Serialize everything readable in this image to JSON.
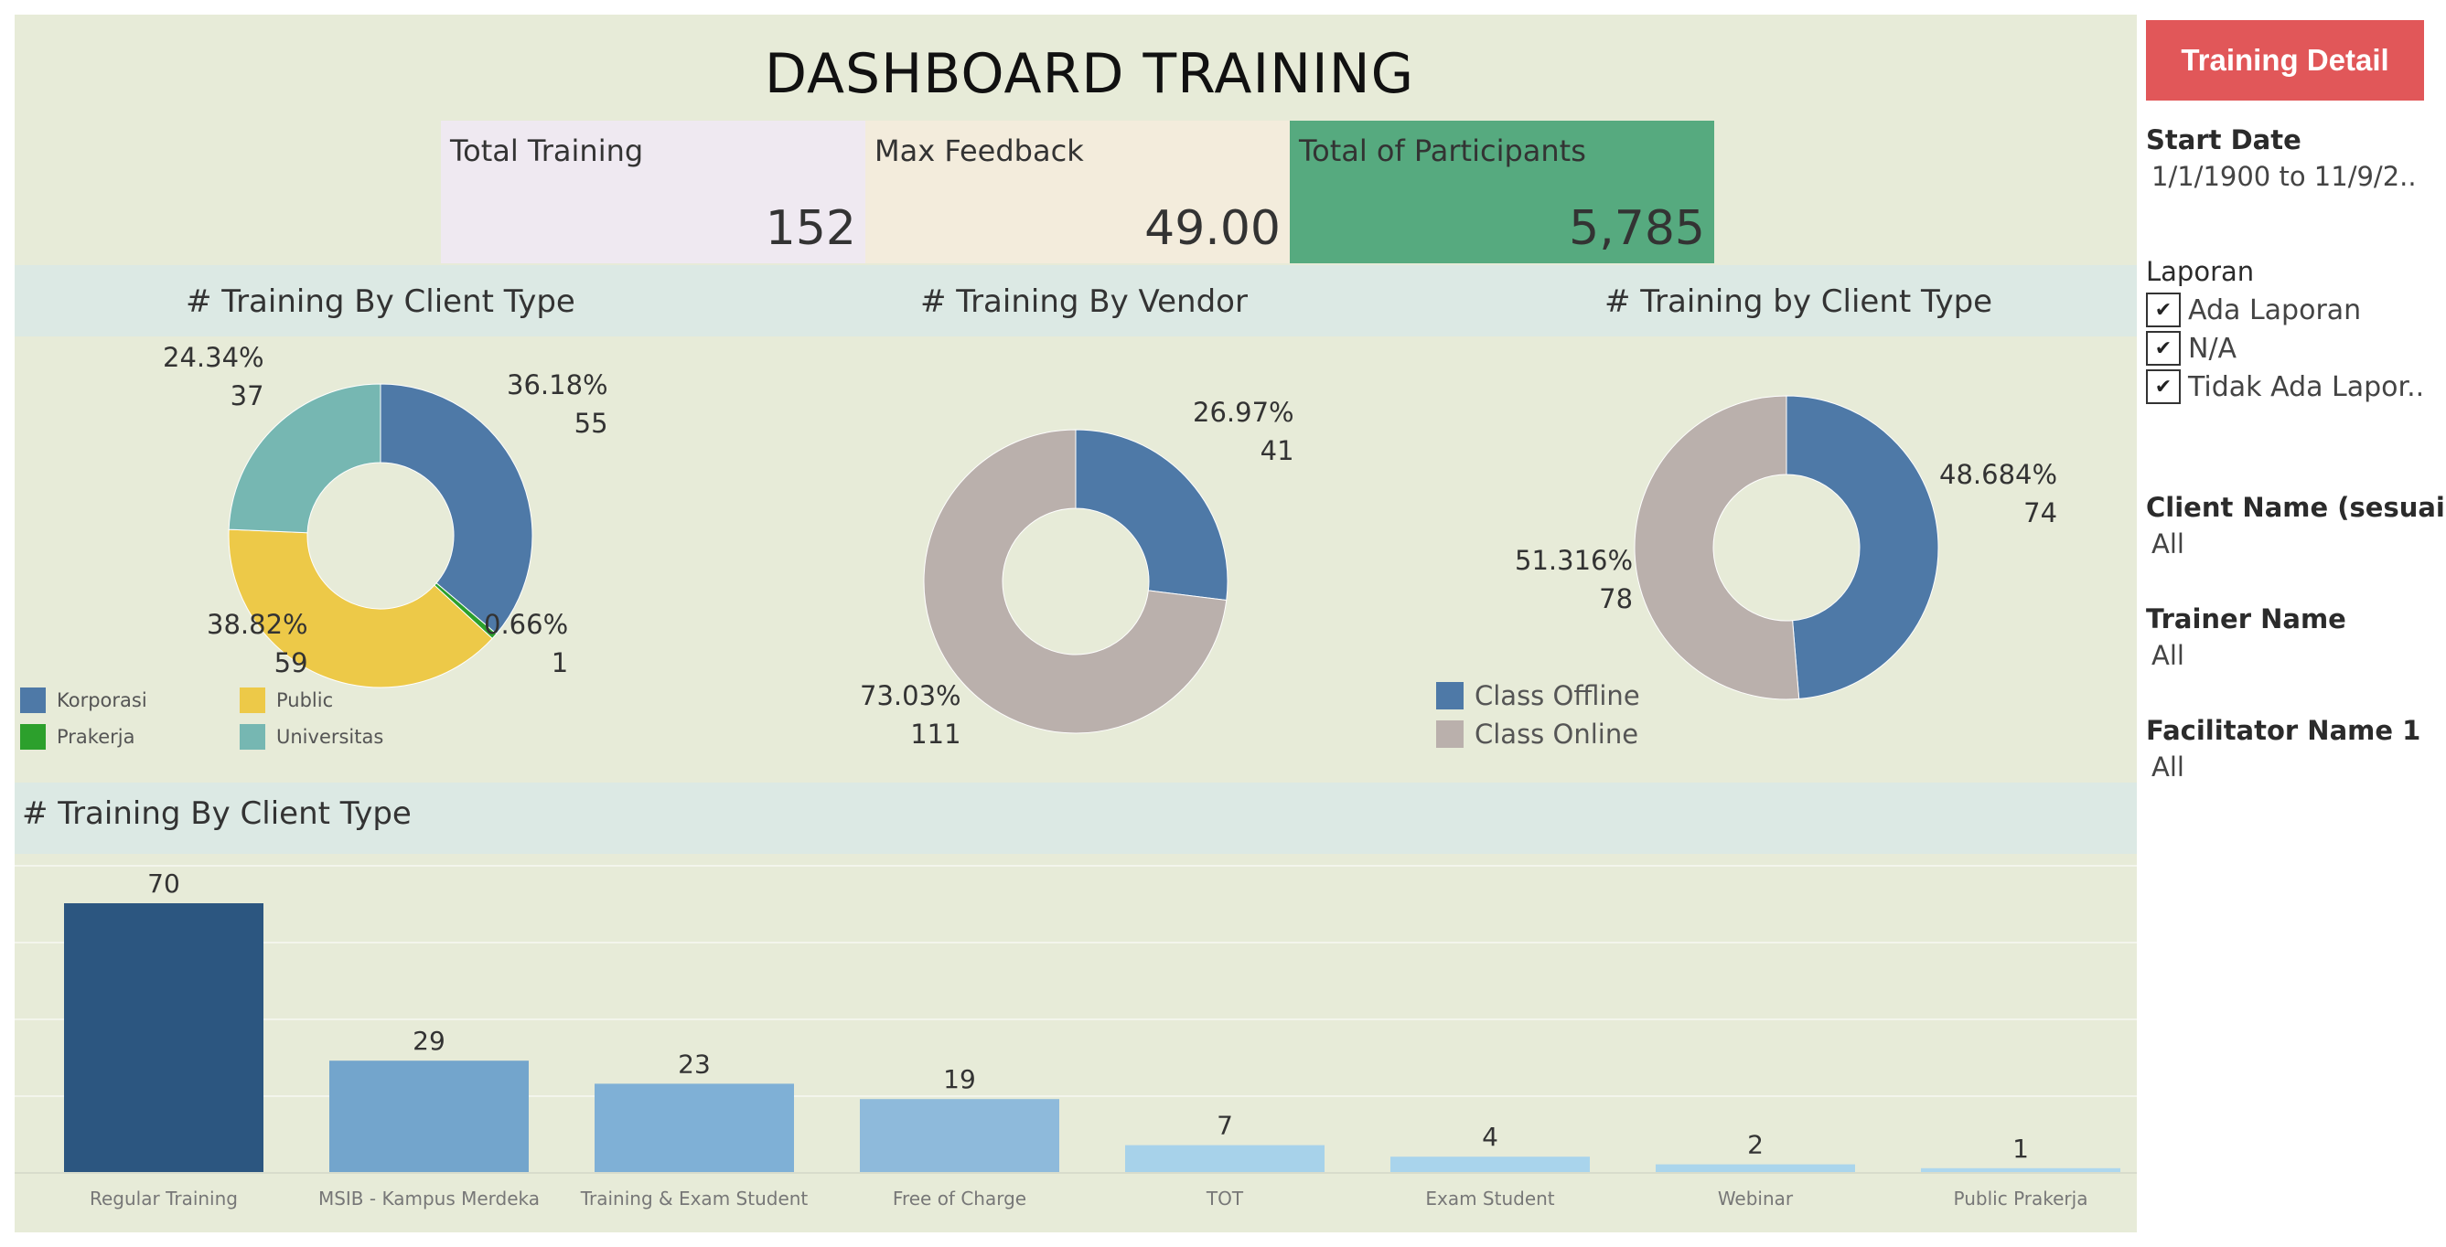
{
  "header": {
    "title": "DASHBOARD TRAINING"
  },
  "kpis": [
    {
      "label": "Total Training",
      "value": "152"
    },
    {
      "label": "Max Feedback",
      "value": "49.00"
    },
    {
      "label": "Total of Participants",
      "value": "5,785"
    }
  ],
  "sections": {
    "client_type_donut": "# Training By Client Type",
    "vendor_donut": "# Training By Vendor",
    "class_donut": "# Training by Client Type",
    "bar_chart": "# Training By Client Type"
  },
  "colors": {
    "korporasi": "#4e79a7",
    "public": "#edc948",
    "prakerja": "#2ca02c",
    "universitas": "#76b7b2",
    "class_online": "#bab0ac",
    "class_offline": "#4e79a7",
    "bar_dark": "#2c5680",
    "panel_button": "#e15759",
    "kpi_green": "#56aa7f"
  },
  "chart_data": [
    {
      "type": "pie",
      "title": "# Training By Client Type",
      "series": [
        {
          "name": "Korporasi",
          "value": 55,
          "percent": "36.18%"
        },
        {
          "name": "Prakerja",
          "value": 1,
          "percent": "0.66%"
        },
        {
          "name": "Public",
          "value": 59,
          "percent": "38.82%"
        },
        {
          "name": "Universitas",
          "value": 37,
          "percent": "24.34%"
        }
      ],
      "legend": [
        "Korporasi",
        "Public",
        "Prakerja",
        "Universitas"
      ]
    },
    {
      "type": "pie",
      "title": "# Training By Vendor",
      "series": [
        {
          "value": 41,
          "percent": "26.97%"
        },
        {
          "value": 111,
          "percent": "73.03%"
        }
      ]
    },
    {
      "type": "pie",
      "title": "# Training by Client Type",
      "series": [
        {
          "name": "Class Offline",
          "value": 74,
          "percent": "48.684%"
        },
        {
          "name": "Class Online",
          "value": 78,
          "percent": "51.316%"
        }
      ],
      "legend": [
        "Class Offline",
        "Class Online"
      ]
    },
    {
      "type": "bar",
      "title": "# Training By Client Type",
      "categories": [
        "Regular Training",
        "MSIB - Kampus Merdeka",
        "Training & Exam Student",
        "Free of Charge",
        "TOT",
        "Exam Student",
        "Webinar",
        "Public Prakerja"
      ],
      "values": [
        70,
        29,
        23,
        19,
        7,
        4,
        2,
        1
      ],
      "colors": [
        "#2c5680",
        "#73a5cc",
        "#7fb0d6",
        "#8ebadb",
        "#a7d2ea",
        "#a9d4ec",
        "#aad5ec",
        "#add7ee"
      ],
      "ylim": [
        0,
        80
      ],
      "grid": true
    }
  ],
  "filters": {
    "button_label": "Training Detail",
    "start_date": {
      "title": "Start Date",
      "value": "1/1/1900 to 11/9/2.."
    },
    "laporan": {
      "title": "Laporan",
      "options": [
        {
          "label": "Ada Laporan",
          "checked": "✔"
        },
        {
          "label": "N/A",
          "checked": "✔"
        },
        {
          "label": "Tidak Ada Lapor..",
          "checked": "✔"
        }
      ]
    },
    "client_name": {
      "title": "Client Name (sesuai ..",
      "value": "All"
    },
    "trainer_name": {
      "title": "Trainer Name",
      "value": "All"
    },
    "facilitator_name": {
      "title": "Facilitator Name 1",
      "value": "All"
    }
  }
}
